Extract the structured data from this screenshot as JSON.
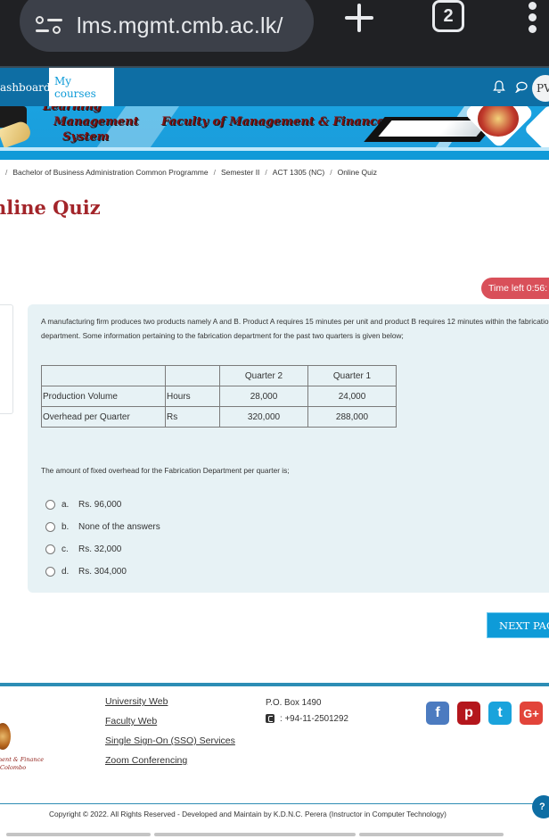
{
  "browser": {
    "url": "lms.mgmt.cmb.ac.lk/",
    "tab_count": "2"
  },
  "navbar": {
    "dashboard_label": "ashboard",
    "my_courses_label": "My courses",
    "avatar_initials": "PV"
  },
  "banner": {
    "lms_line1": "Learning",
    "lms_line2": "Management",
    "lms_line3": "System",
    "faculty": "Faculty of Management & Finance"
  },
  "breadcrumb": [
    "Bachelor of Business Administration Common Programme",
    "Semester II",
    "ACT 1305 (NC)",
    "Online Quiz"
  ],
  "page_title": "nline Quiz",
  "timer": "Time left 0:56:",
  "question": {
    "text": "A manufacturing firm produces two products namely A and B. Product A requires 15 minutes per unit and product B requires 12 minutes within the fabrication department. Some information pertaining to the fabrication department for the past two quarters is given below;",
    "table": {
      "headers": [
        "",
        "",
        "Quarter 2",
        "Quarter 1"
      ],
      "rows": [
        [
          "Production Volume",
          "Hours",
          "28,000",
          "24,000"
        ],
        [
          "Overhead per Quarter",
          "Rs",
          "320,000",
          "288,000"
        ]
      ]
    },
    "prompt": "The amount of fixed overhead for the Fabrication Department per quarter is;",
    "answers": [
      {
        "letter": "a.",
        "text": "Rs. 96,000"
      },
      {
        "letter": "b.",
        "text": "None of the answers"
      },
      {
        "letter": "c.",
        "text": "Rs. 32,000"
      },
      {
        "letter": "d.",
        "text": "Rs. 304,000"
      }
    ]
  },
  "next_button": "NEXT PAGE",
  "footer": {
    "logo_text1": "ment & Finance",
    "logo_text2": "Colombo",
    "links": [
      "University Web",
      "Faculty Web",
      "Single Sign-On (SSO) Services",
      "Zoom Conferencing"
    ],
    "po_box": "P.O. Box 1490",
    "phone": ": +94-11-2501292",
    "socials": [
      {
        "name": "facebook",
        "glyph": "f"
      },
      {
        "name": "pinterest",
        "glyph": "p"
      },
      {
        "name": "twitter",
        "glyph": "t"
      },
      {
        "name": "google-plus",
        "glyph": "G+"
      }
    ],
    "copyright": "Copyright © 2022. All Rights Reserved - Developed and Maintain by K.D.N.C. Perera (Instructor in Computer Technology)",
    "help": "?"
  }
}
